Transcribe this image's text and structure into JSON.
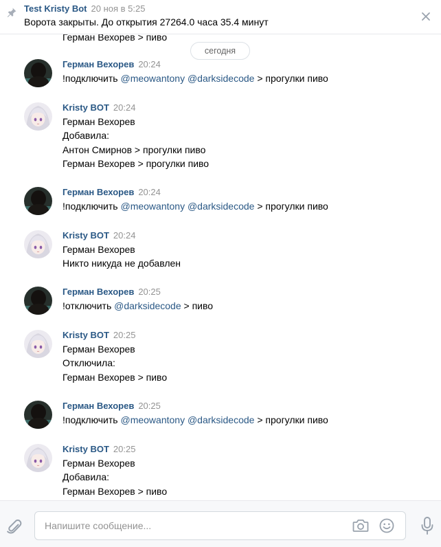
{
  "pinned": {
    "title": "Test Kristy Bot",
    "date": "20 ноя в 5:25",
    "text": "Ворота закрыты. До открытия 27264.0 часа 35.4 минут"
  },
  "feed": {
    "cut_line": "Герман Вехорев > пиво",
    "date_divider": "сегодня"
  },
  "messages": [
    {
      "author": "Герман Вехорев",
      "time": "20:24",
      "lines": [
        [
          {
            "t": "!подключить "
          },
          {
            "t": "@meowantony",
            "mention": true
          },
          {
            "t": " "
          },
          {
            "t": "@darksidecode",
            "mention": true
          },
          {
            "t": " > прогулки пиво"
          }
        ]
      ]
    },
    {
      "author": "Kristy BOT",
      "time": "20:24",
      "lines": [
        [
          {
            "t": "Герман Вехорев"
          }
        ],
        [
          {
            "t": "Добавила:"
          }
        ],
        [
          {
            "t": "Антон Смирнов > прогулки пиво"
          }
        ],
        [
          {
            "t": "Герман Вехорев > прогулки пиво"
          }
        ]
      ]
    },
    {
      "author": "Герман Вехорев",
      "time": "20:24",
      "lines": [
        [
          {
            "t": "!подключить "
          },
          {
            "t": "@meowantony",
            "mention": true
          },
          {
            "t": " "
          },
          {
            "t": "@darksidecode",
            "mention": true
          },
          {
            "t": " > прогулки пиво"
          }
        ]
      ]
    },
    {
      "author": "Kristy BOT",
      "time": "20:24",
      "lines": [
        [
          {
            "t": "Герман Вехорев"
          }
        ],
        [
          {
            "t": "Никто никуда не добавлен"
          }
        ]
      ]
    },
    {
      "author": "Герман Вехорев",
      "time": "20:25",
      "lines": [
        [
          {
            "t": "!отключить "
          },
          {
            "t": "@darksidecode",
            "mention": true
          },
          {
            "t": " > пиво"
          }
        ]
      ]
    },
    {
      "author": "Kristy BOT",
      "time": "20:25",
      "lines": [
        [
          {
            "t": "Герман Вехорев"
          }
        ],
        [
          {
            "t": "Отключила:"
          }
        ],
        [
          {
            "t": "Герман Вехорев > пиво"
          }
        ]
      ]
    },
    {
      "author": "Герман Вехорев",
      "time": "20:25",
      "lines": [
        [
          {
            "t": "!подключить "
          },
          {
            "t": "@meowantony",
            "mention": true
          },
          {
            "t": " "
          },
          {
            "t": "@darksidecode",
            "mention": true
          },
          {
            "t": " > прогулки пиво"
          }
        ]
      ]
    },
    {
      "author": "Kristy BOT",
      "time": "20:25",
      "lines": [
        [
          {
            "t": "Герман Вехорев"
          }
        ],
        [
          {
            "t": "Добавила:"
          }
        ],
        [
          {
            "t": "Герман Вехорев > пиво"
          }
        ]
      ]
    }
  ],
  "composer": {
    "placeholder": "Напишите сообщение...",
    "value": ""
  },
  "colors": {
    "link": "#2a5885",
    "meta": "#939393",
    "panel": "#f7f8fa"
  },
  "icons": {
    "pin": "pin-icon",
    "close": "close-icon",
    "attach": "paperclip-icon",
    "camera": "camera-icon",
    "smile": "smile-icon",
    "mic": "microphone-icon"
  }
}
